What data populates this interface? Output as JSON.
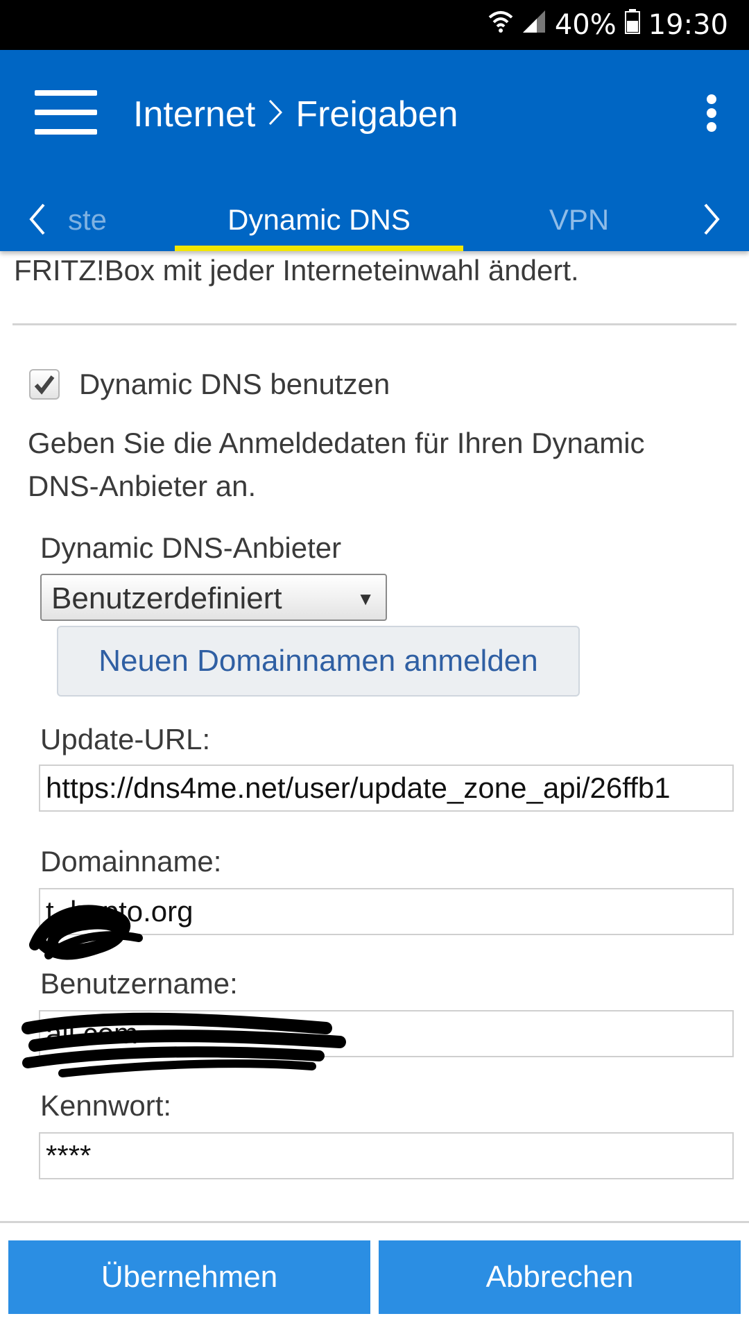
{
  "status_bar": {
    "battery": "40%",
    "time": "19:30"
  },
  "header": {
    "crumb_parent": "Internet",
    "crumb_separator": "›",
    "crumb_current": "Freigaben"
  },
  "tabs": {
    "prev_partial": "ste",
    "active": "Dynamic DNS",
    "next": "VPN"
  },
  "content": {
    "cut_text": "FRITZ!Box mit jeder Interneteinwahl ändert.",
    "checkbox_label": "Dynamic DNS benutzen",
    "checkbox_checked": true,
    "description": "Geben Sie die Anmeldedaten für Ihren Dynamic DNS-Anbieter an.",
    "provider_label": "Dynamic DNS-Anbieter",
    "provider_value": "Benutzerdefiniert",
    "register_button": "Neuen Domainnamen anmelden",
    "update_url_label": "Update-URL:",
    "update_url_value": "https://dns4me.net/user/update_zone_api/26ffb1",
    "domain_label": "Domainname:",
    "domain_value": "t      .hopto.org",
    "username_label": "Benutzername:",
    "username_value": "                               ail.com",
    "password_label": "Kennwort:",
    "password_value": "****"
  },
  "footer": {
    "apply": "Übernehmen",
    "cancel": "Abbrechen"
  },
  "colors": {
    "appbar": "#0066c4",
    "tab_indicator": "#f2e600",
    "button": "#2b8ee3"
  }
}
